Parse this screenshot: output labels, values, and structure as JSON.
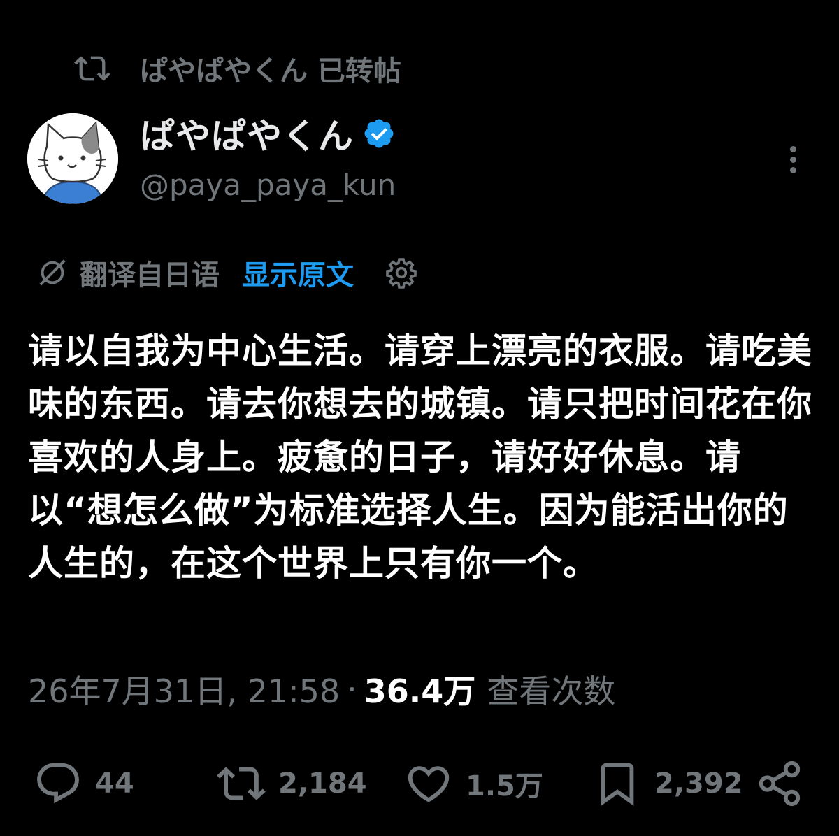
{
  "retweet_bar": {
    "icon": "retweet-icon",
    "text": "ぱやぱやくん 已转帖"
  },
  "author": {
    "avatar": "cat-avatar",
    "display_name": "ぱやぱやくん",
    "verified_icon": "verified-badge-icon",
    "verified_color": "#1d9bf0",
    "handle": "@paya_paya_kun"
  },
  "more_icon": "more-vertical-icon",
  "translation": {
    "icon": "translate-icon",
    "label": "翻译自日语",
    "show_original": "显示原文",
    "settings_icon": "gear-icon",
    "link_color": "#1d9bf0"
  },
  "tweet": {
    "text": "请以自我为中心生活。请穿上漂亮的衣服。请吃美味的东西。请去你想去的城镇。请只把时间花在你喜欢的人身上。疲惫的日子，请好好休息。请以“想怎么做”为标准选择人生。因为能活出你的人生的，在这个世界上只有你一个。"
  },
  "meta": {
    "timestamp": "26年7月31日, 21:58",
    "separator": "·",
    "views_count": "36.4万",
    "views_label": "查看次数"
  },
  "actions": {
    "reply": {
      "icon": "reply-icon",
      "count": "44"
    },
    "retweet": {
      "icon": "retweet-icon",
      "count": "2,184"
    },
    "like": {
      "icon": "heart-icon",
      "count": "1.5万"
    },
    "bookmark": {
      "icon": "bookmark-icon",
      "count": "2,392"
    },
    "share": {
      "icon": "share-icon"
    }
  },
  "colors": {
    "background": "#000000",
    "primary_text": "#ffffff",
    "secondary_text": "#71767b",
    "accent": "#1d9bf0"
  }
}
